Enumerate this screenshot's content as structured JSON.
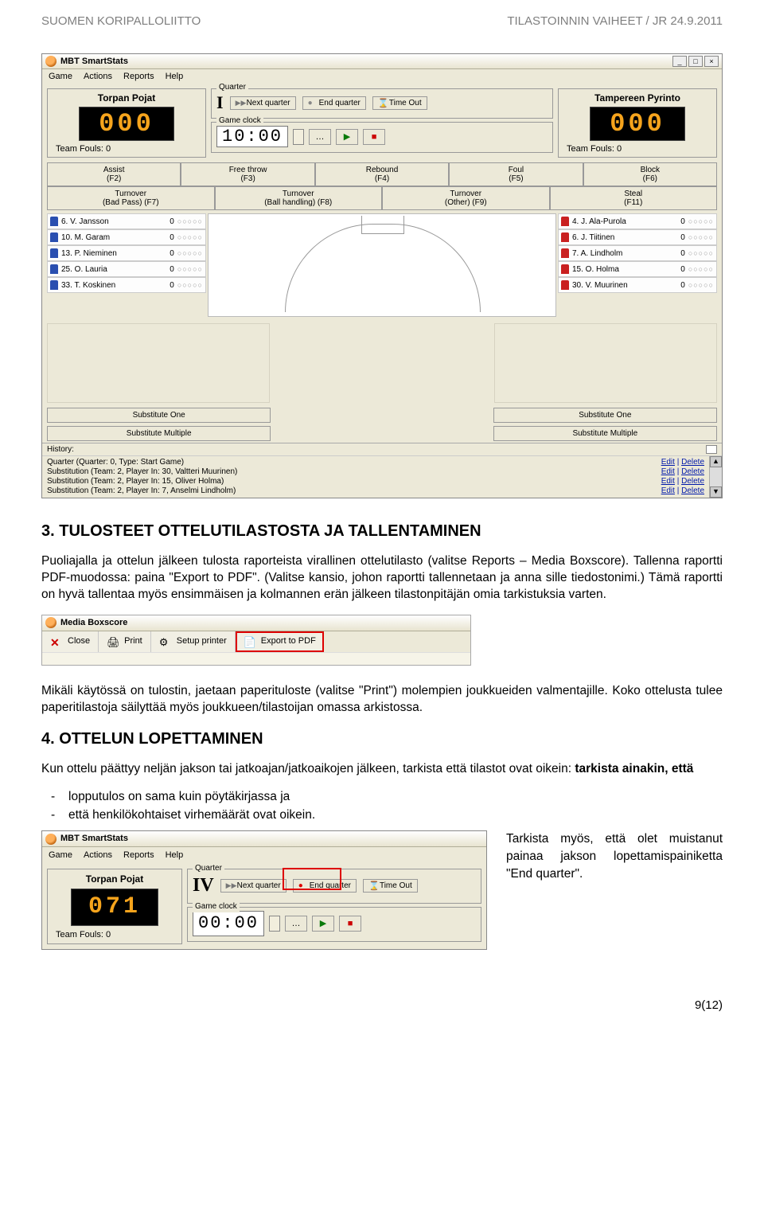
{
  "doc_header": {
    "left": "SUOMEN KORIPALLOLIITTO",
    "right": "TILASTOINNIN VAIHEET / JR  24.9.2011"
  },
  "app": {
    "title": "MBT SmartStats",
    "menu": [
      "Game",
      "Actions",
      "Reports",
      "Help"
    ],
    "home_team": "Torpan Pojat",
    "away_team": "Tampereen Pyrinto",
    "home_score": "000",
    "away_score": "000",
    "team_fouls_label": "Team Fouls: 0",
    "quarter_label": "Quarter",
    "quarter_value": "I",
    "next_quarter": "Next quarter",
    "end_quarter": "End quarter",
    "time_out": "Time Out",
    "game_clock_label": "Game clock",
    "game_clock_value": "10:00",
    "clock_dots": "…",
    "actions_row1": [
      "Assist (F2)",
      "Free throw (F3)",
      "Rebound (F4)",
      "Foul (F5)",
      "Block (F6)"
    ],
    "actions_row2": [
      "Turnover (Bad Pass) (F7)",
      "Turnover (Ball handling) (F8)",
      "Turnover (Other) (F9)",
      "Steal (F11)"
    ],
    "home_players": [
      {
        "num": "6",
        "name": "V. Jansson"
      },
      {
        "num": "10",
        "name": "M. Garam"
      },
      {
        "num": "13",
        "name": "P. Nieminen"
      },
      {
        "num": "25",
        "name": "O. Lauria"
      },
      {
        "num": "33",
        "name": "T. Koskinen"
      }
    ],
    "away_players": [
      {
        "num": "4",
        "name": "J. Ala-Purola"
      },
      {
        "num": "6",
        "name": "J. Tiitinen"
      },
      {
        "num": "7",
        "name": "A. Lindholm"
      },
      {
        "num": "15",
        "name": "O. Holma"
      },
      {
        "num": "30",
        "name": "V. Muurinen"
      }
    ],
    "sub_one": "Substitute One",
    "sub_multi": "Substitute Multiple",
    "history_label": "History:",
    "history_items": [
      "Quarter (Quarter: 0, Type: Start Game)",
      "Substitution (Team: 2, Player In: 30, Valtteri Muurinen)",
      "Substitution (Team: 2, Player In: 15, Oliver Holma)",
      "Substitution (Team: 2, Player In: 7, Anselmi Lindholm)"
    ],
    "hist_edit": "Edit",
    "hist_delete": "Delete"
  },
  "section3": {
    "heading": "3. TULOSTEET OTTELUTILASTOSTA JA TALLENTAMINEN",
    "p1": "Puoliajalla ja ottelun jälkeen tulosta raporteista virallinen ottelutilasto (valitse Reports – Media Boxscore). Tallenna raportti PDF-muodossa: paina \"Export to PDF\". (Valitse kansio, johon raportti tallennetaan ja anna sille tiedostonimi.) Tämä raportti on hyvä tallentaa myös ensimmäisen ja kolmannen erän jälkeen tilastonpitäjän omia tarkistuksia varten.",
    "p2": "Mikäli käytössä on tulostin, jaetaan paperituloste (valitse \"Print\") molempien joukkueiden valmentajille. Koko ottelusta tulee paperitilastoja säilyttää myös joukkueen/tilastoijan omassa arkistossa."
  },
  "mb": {
    "title": "Media Boxscore",
    "close": "Close",
    "print": "Print",
    "setup": "Setup printer",
    "export": "Export to PDF"
  },
  "section4": {
    "heading": "4. OTTELUN LOPETTAMINEN",
    "intro": "Kun ottelu päättyy neljän jakson tai jatkoajan/jatkoaikojen jälkeen, tarkista että tilastot ovat oikein: ",
    "intro_bold": "tarkista ainakin, että",
    "bullets": [
      "lopputulos on sama kuin pöytäkirjassa ja",
      "että henkilökohtaiset virhemäärät ovat oikein."
    ],
    "side_text": "Tarkista myös, että olet muistanut painaa jakson lopettamispainiketta \"End quarter\"."
  },
  "eq_app": {
    "quarter_value": "IV",
    "home_score": "071",
    "clock": "00:00"
  },
  "page_num": "9(12)"
}
